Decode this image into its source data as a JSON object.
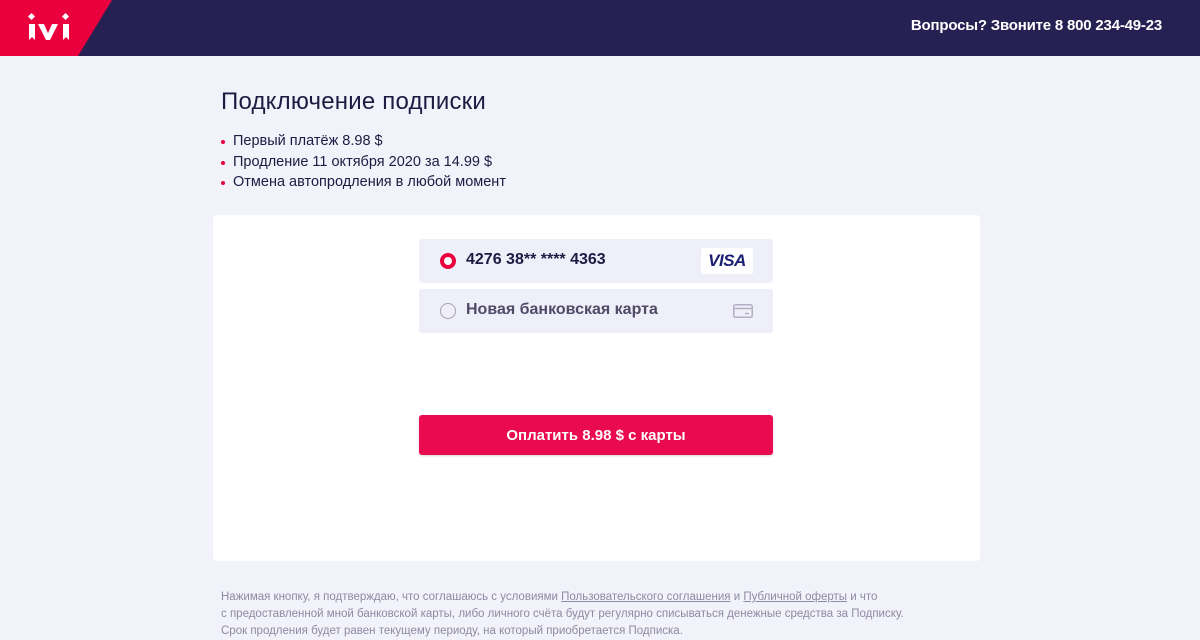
{
  "header": {
    "phone_text": "Вопросы? Звоните 8 800 234-49-23",
    "logo_text": "ivi",
    "colors": {
      "background": "#262152",
      "logo_accent": "#ea003d"
    }
  },
  "main": {
    "title": "Подключение подписки",
    "bullets": [
      "Первый платёж 8.98 $",
      "Продление 11 октября 2020 за 14.99 $",
      "Отмена автопродления в любой момент"
    ]
  },
  "payment": {
    "options": [
      {
        "label": "4276 38** **** 4363",
        "selected": true,
        "icon": "visa-logo",
        "icon_text": "VISA"
      },
      {
        "label": "Новая банковская карта",
        "selected": false,
        "icon": "credit-card-icon"
      }
    ],
    "pay_button_label": "Оплатить 8.98 $ с карты",
    "accent_color": "#ea0a4f"
  },
  "legal": {
    "part1": "Нажимая кнопку, я подтверждаю, что соглашаюсь с условиями ",
    "link1": "Пользовательского соглашения",
    "part2": " и ",
    "link2": "Публичной оферты",
    "part3": " и что",
    "line2": "с предоставленной мной банковской карты, либо личного счёта будут регулярно списываться денежные средства за Подписку.",
    "line3": "Срок продления будет равен текущему периоду, на который приобретается Подписка."
  }
}
